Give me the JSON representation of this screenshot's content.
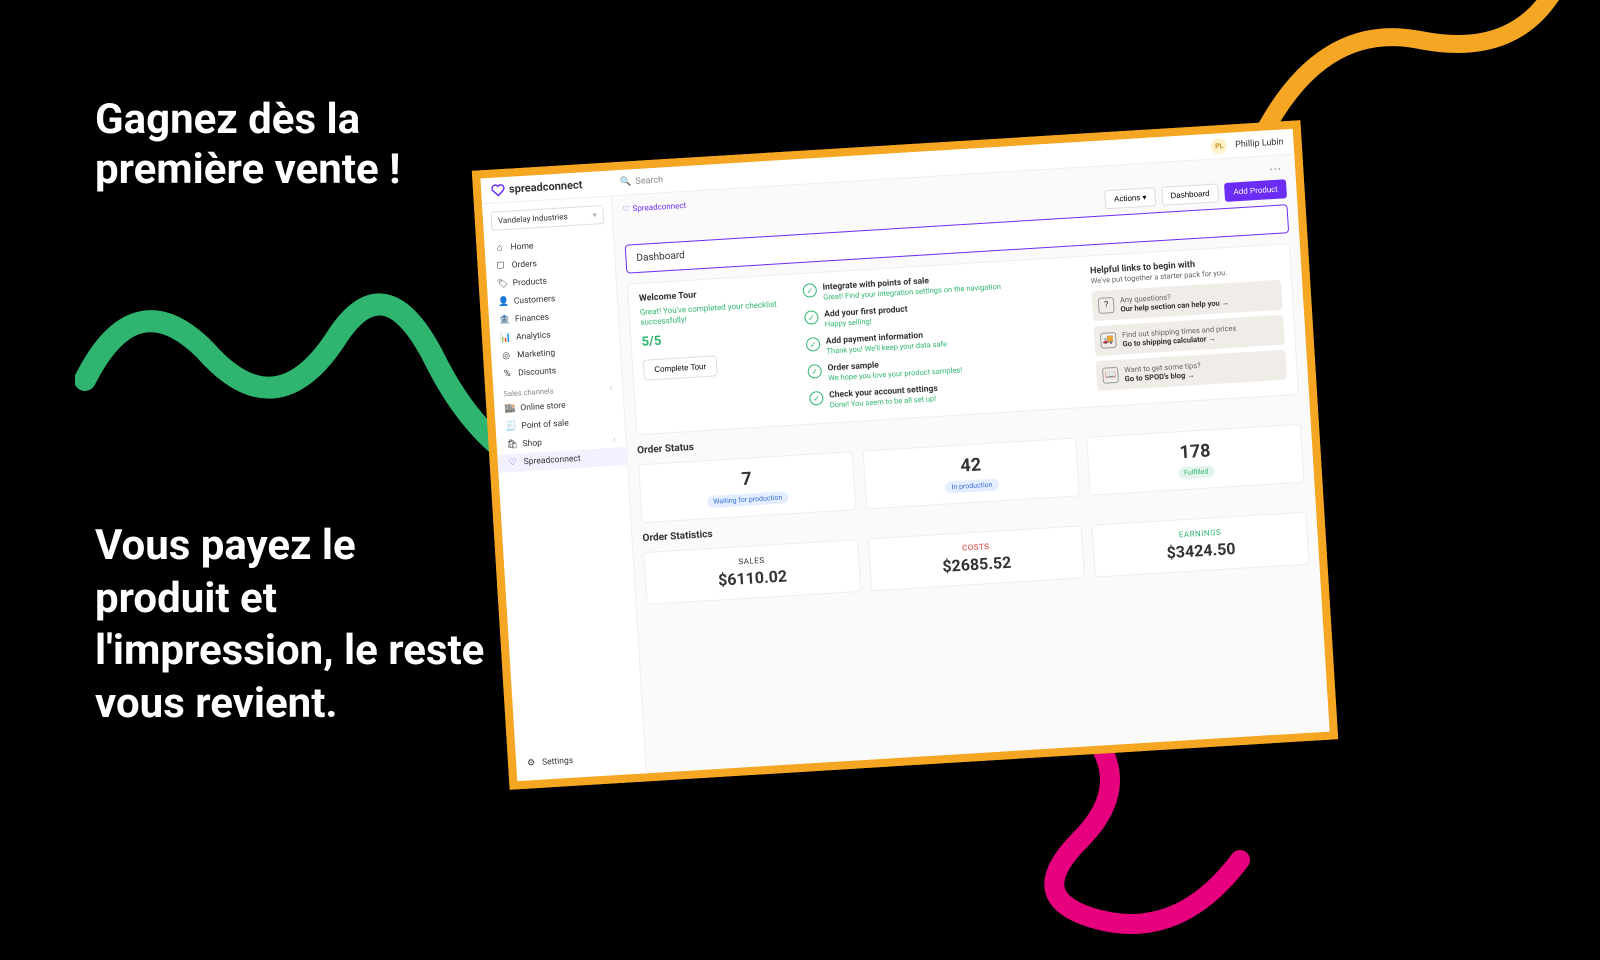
{
  "marketing": {
    "headline_top": "Gagnez dès la première vente !",
    "headline_bottom": "Vous payez le produit et l'impression, le reste vous revient."
  },
  "colors": {
    "orange": "#f5a623",
    "green": "#2fb56f",
    "pink": "#e6007e",
    "purple": "#6b2cf5"
  },
  "topbar": {
    "brand": "spreadconnect",
    "search_placeholder": "Search",
    "user_initials": "PL",
    "user_name": "Phillip Lubin"
  },
  "sidebar": {
    "shop": "Vandelay Industries",
    "nav": [
      {
        "icon": "home",
        "label": "Home"
      },
      {
        "icon": "orders",
        "label": "Orders"
      },
      {
        "icon": "products",
        "label": "Products"
      },
      {
        "icon": "customers",
        "label": "Customers"
      },
      {
        "icon": "finances",
        "label": "Finances"
      },
      {
        "icon": "analytics",
        "label": "Analytics"
      },
      {
        "icon": "marketing",
        "label": "Marketing"
      },
      {
        "icon": "discounts",
        "label": "Discounts"
      }
    ],
    "channels_title": "Sales channels",
    "channels": [
      {
        "icon": "store",
        "label": "Online store"
      },
      {
        "icon": "pos",
        "label": "Point of sale"
      },
      {
        "icon": "shop",
        "label": "Shop"
      }
    ],
    "active": "Spreadconnect",
    "settings": "Settings"
  },
  "crumb": {
    "app": "Spreadconnect",
    "actions": "Actions",
    "dashboard_btn": "Dashboard",
    "add_product": "Add Product"
  },
  "dashboard": {
    "title": "Dashboard",
    "welcome": {
      "heading": "Welcome Tour",
      "message": "Great! You've completed your checklist successfully!",
      "fraction": "5/5",
      "complete_btn": "Complete Tour"
    },
    "checklist": [
      {
        "title": "Integrate with points of sale",
        "sub": "Great! Find your integration settings on the navigation"
      },
      {
        "title": "Add your first product",
        "sub": "Happy selling!"
      },
      {
        "title": "Add payment information",
        "sub": "Thank you! We'll keep your data safe"
      },
      {
        "title": "Order sample",
        "sub": "We hope you love your product samples!"
      },
      {
        "title": "Check your account settings",
        "sub": "Done! You seem to be all set up!"
      }
    ],
    "helpful": {
      "heading": "Helpful links to begin with",
      "sub": "We've put together a starter pack for you.",
      "links": [
        {
          "icon": "?",
          "q": "Any questions?",
          "a": "Our help section can help you →"
        },
        {
          "icon": "truck",
          "q": "Find out shipping times and prices",
          "a": "Go to shipping calculator →"
        },
        {
          "icon": "book",
          "q": "Want to get some tips?",
          "a": "Go to SPOD's blog →"
        }
      ]
    },
    "order_status": {
      "title": "Order Status",
      "items": [
        {
          "value": "7",
          "label": "Waiting for production",
          "pill": "blue"
        },
        {
          "value": "42",
          "label": "In production",
          "pill": "blue"
        },
        {
          "value": "178",
          "label": "Fulfilled",
          "pill": "green"
        }
      ]
    },
    "order_stats": {
      "title": "Order Statistics",
      "items": [
        {
          "label": "SALES",
          "value": "$6110.02",
          "cls": "black"
        },
        {
          "label": "COSTS",
          "value": "$2685.52",
          "cls": "red"
        },
        {
          "label": "EARNINGS",
          "value": "$3424.50",
          "cls": "green"
        }
      ]
    }
  }
}
